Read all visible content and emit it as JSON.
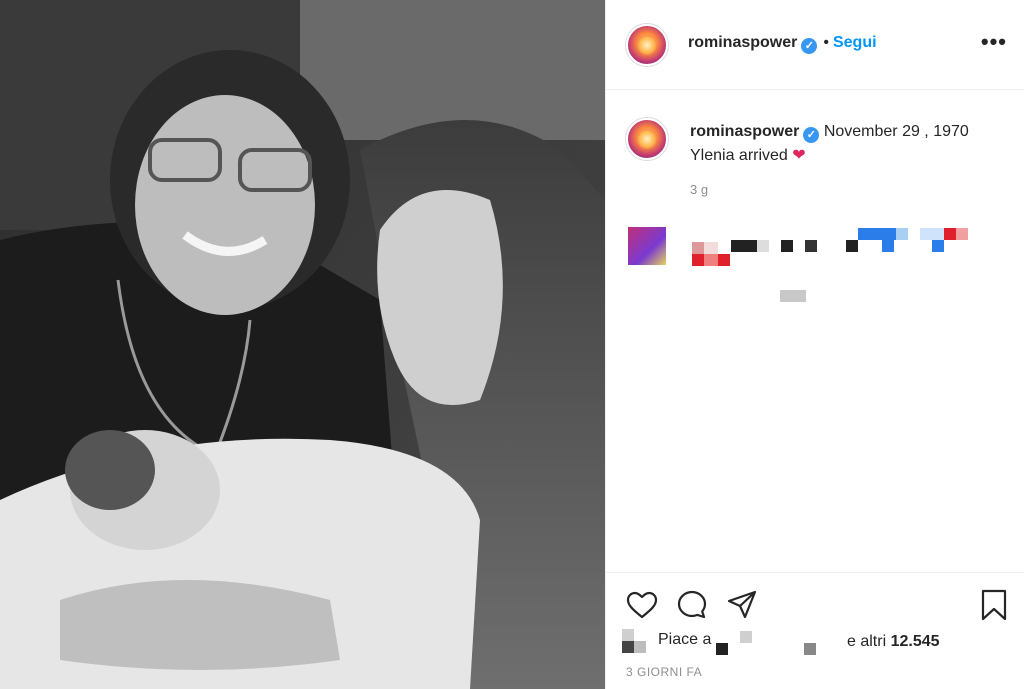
{
  "post": {
    "username": "rominaspower",
    "follow_label": "Segui",
    "header_separator": "•",
    "more_label": "•••",
    "caption_text": "November 29 , 1970 Ylenia arrived",
    "caption_emoji": "❤",
    "caption_time": "3 g",
    "likes_prefix": "Piace a",
    "likes_suffix_pre": "e altri",
    "likes_count": "12.545",
    "footer_time": "3 GIORNI FA"
  },
  "icons": {
    "verified": "verified-badge-icon",
    "like": "heart-icon",
    "comment": "comment-icon",
    "share": "paper-plane-icon",
    "save": "bookmark-icon"
  },
  "colors": {
    "accent": "#0095f6",
    "verified": "#3897f0",
    "heart": "#e0245e",
    "muted": "#8e8e8e"
  }
}
